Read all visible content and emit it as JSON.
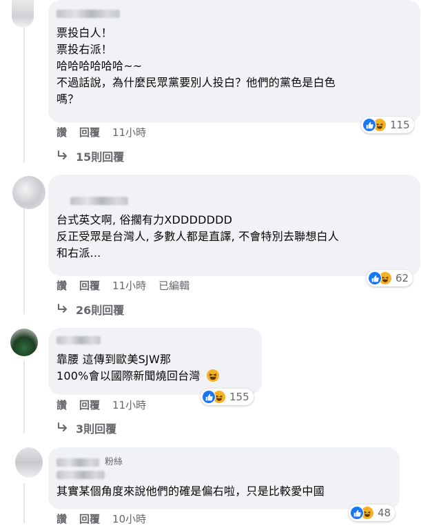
{
  "comments": [
    {
      "lines": [
        "票投白人！",
        "票投右派！",
        "哈哈哈哈哈哈~~",
        "不過話說，為什麼民眾黨要別人投白？他們的黨色是白色",
        "嗎？"
      ],
      "reaction_count": "115",
      "actions": {
        "like": "讚",
        "reply": "回覆",
        "time": "11小時"
      },
      "replies": "15則回覆"
    },
    {
      "lines": [
        "台式英文啊, 俗擱有力XDDDDDDD",
        "反正受眾是台灣人, 多數人都是直譯, 不會特別去聯想白人",
        "和右派..."
      ],
      "reaction_count": "62",
      "actions": {
        "like": "讚",
        "reply": "回覆",
        "time": "11小時",
        "edited": "已編輯"
      },
      "replies": "26則回覆"
    },
    {
      "lines": [
        "靠腰 這傳到歐美SJW那",
        "100%會以國際新聞燒回台灣"
      ],
      "reaction_count": "155",
      "actions": {
        "like": "讚",
        "reply": "回覆",
        "time": "11小時"
      },
      "replies": "3則回覆"
    },
    {
      "follower_suffix": "粉絲",
      "lines": [
        "其實某個角度來說他們的確是偏右啦，只是比較愛中國"
      ],
      "reaction_count": "48",
      "actions": {
        "like": "讚",
        "reply": "回覆",
        "time": "10小時"
      }
    }
  ],
  "colors": {
    "like_blue": "#1877f2",
    "haha_yellow": "#f7b125",
    "bubble_gray": "#f0f2f5",
    "meta_gray": "#65676b"
  }
}
